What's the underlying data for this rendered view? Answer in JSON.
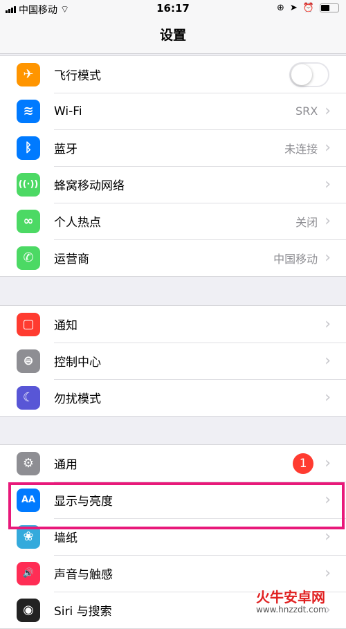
{
  "status": {
    "carrier": "中国移动",
    "time": "16:17"
  },
  "nav": {
    "title": "设置"
  },
  "groups": [
    [
      {
        "label": "飞行模式",
        "icon": "airplane-icon",
        "color": "#ff9500",
        "glyph": "✈",
        "toggle": false
      },
      {
        "label": "Wi-Fi",
        "icon": "wifi-icon",
        "color": "#007aff",
        "glyph": "≋",
        "value": "SRX"
      },
      {
        "label": "蓝牙",
        "icon": "bluetooth-icon",
        "color": "#007aff",
        "glyph": "ᛒ",
        "value": "未连接"
      },
      {
        "label": "蜂窝移动网络",
        "icon": "cellular-icon",
        "color": "#4cd964",
        "glyph": "((·))"
      },
      {
        "label": "个人热点",
        "icon": "hotspot-icon",
        "color": "#4cd964",
        "glyph": "∞",
        "value": "关闭"
      },
      {
        "label": "运营商",
        "icon": "phone-icon",
        "color": "#4cd964",
        "glyph": "✆",
        "value": "中国移动"
      }
    ],
    [
      {
        "label": "通知",
        "icon": "notifications-icon",
        "color": "#ff3b30",
        "glyph": "▢"
      },
      {
        "label": "控制中心",
        "icon": "control-center-icon",
        "color": "#8e8e93",
        "glyph": "⊜"
      },
      {
        "label": "勿扰模式",
        "icon": "moon-icon",
        "color": "#5856d6",
        "glyph": "☾"
      }
    ],
    [
      {
        "label": "通用",
        "icon": "gear-icon",
        "color": "#8e8e93",
        "glyph": "⚙",
        "badge": "1"
      },
      {
        "label": "显示与亮度",
        "icon": "display-icon",
        "color": "#007aff",
        "glyph": "AA"
      },
      {
        "label": "墙纸",
        "icon": "wallpaper-icon",
        "color": "#34aadc",
        "glyph": "❀"
      },
      {
        "label": "声音与触感",
        "icon": "sound-icon",
        "color": "#ff2d55",
        "glyph": "🔊"
      },
      {
        "label": "Siri 与搜索",
        "icon": "siri-icon",
        "color": "#222222",
        "glyph": "◉"
      }
    ]
  ],
  "highlight_color": "#e8197a",
  "watermark": {
    "name": "火牛安卓网",
    "url": "www.hnzzdt.com"
  }
}
